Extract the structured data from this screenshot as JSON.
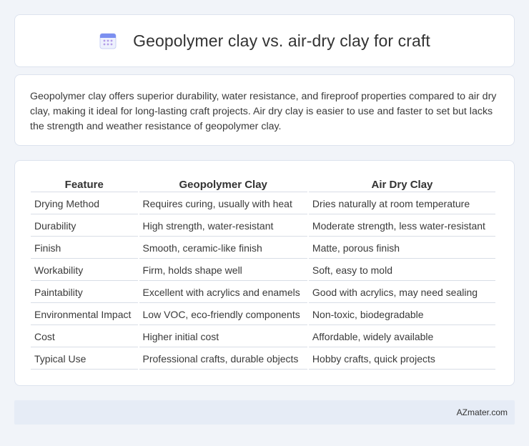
{
  "header": {
    "title": "Geopolymer clay vs. air-dry clay for craft",
    "icon": "calendar-icon"
  },
  "summary": {
    "text": "Geopolymer clay offers superior durability, water resistance, and fireproof properties compared to air dry clay, making it ideal for long-lasting craft projects. Air dry clay is easier to use and faster to set but lacks the strength and weather resistance of geopolymer clay."
  },
  "table": {
    "columns": [
      "Feature",
      "Geopolymer Clay",
      "Air Dry Clay"
    ],
    "rows": [
      [
        "Drying Method",
        "Requires curing, usually with heat",
        "Dries naturally at room temperature"
      ],
      [
        "Durability",
        "High strength, water-resistant",
        "Moderate strength, less water-resistant"
      ],
      [
        "Finish",
        "Smooth, ceramic-like finish",
        "Matte, porous finish"
      ],
      [
        "Workability",
        "Firm, holds shape well",
        "Soft, easy to mold"
      ],
      [
        "Paintability",
        "Excellent with acrylics and enamels",
        "Good with acrylics, may need sealing"
      ],
      [
        "Environmental Impact",
        "Low VOC, eco-friendly components",
        "Non-toxic, biodegradable"
      ],
      [
        "Cost",
        "Higher initial cost",
        "Affordable, widely available"
      ],
      [
        "Typical Use",
        "Professional crafts, durable objects",
        "Hobby crafts, quick projects"
      ]
    ]
  },
  "footer": {
    "brand": "AZmater.com"
  },
  "colors": {
    "page_background": "#f1f4f9",
    "card_background": "#ffffff",
    "footer_background": "#e6ecf6",
    "icon_accent": "#7b8ff0"
  }
}
